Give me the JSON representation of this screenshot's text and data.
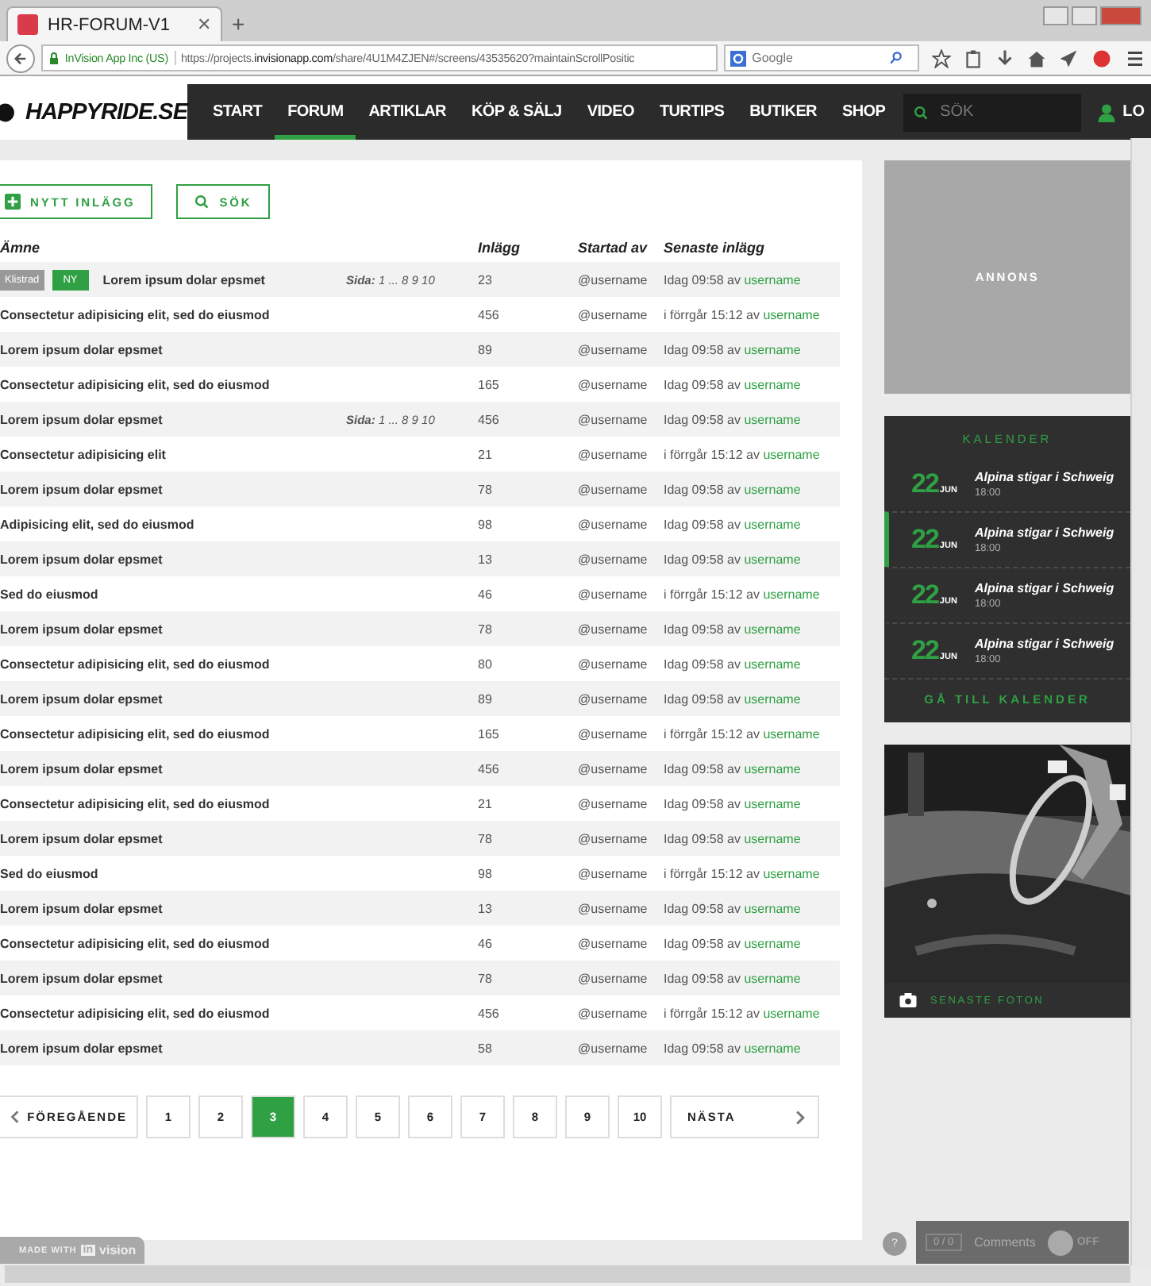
{
  "browser": {
    "tab": "HR-FORUM-V1",
    "tab_close": "✕",
    "new_tab": "+",
    "site_identity": "InVision App Inc (US)",
    "url_prefix": "https://projects.",
    "url_domain": "invisionapp.com",
    "url_rest": "/share/4U1M4ZJEN#/screens/43535620?maintainScrollPositic",
    "search_placeholder": "Google"
  },
  "site": {
    "logo": "HAPPYRIDE.SE",
    "nav": [
      {
        "label": "START",
        "selected": false
      },
      {
        "label": "FORUM",
        "selected": true
      },
      {
        "label": "ARTIKLAR",
        "selected": false
      },
      {
        "label": "KÖP & SÄLJ",
        "selected": false
      },
      {
        "label": "VIDEO",
        "selected": false
      },
      {
        "label": "TURTIPS",
        "selected": false
      },
      {
        "label": "BUTIKER",
        "selected": false
      },
      {
        "label": "SHOP",
        "selected": false
      }
    ],
    "search_placeholder": "SÖK",
    "login": "LO"
  },
  "actions": [
    "NYTT INLÄGG",
    "SÖK"
  ],
  "table": {
    "columns": [
      "Ämne",
      "Inlägg",
      "Startad av",
      "Senaste inlägg"
    ],
    "rows": [
      {
        "tags": [
          "Klistrad",
          "NY"
        ],
        "title": "Lorem ipsum dolar epsmet",
        "pages": {
          "label": "Sida:",
          "value": "1 ... 8 9 10"
        },
        "posts": "23",
        "starter": "@username",
        "latest": "Idag 09:58 av",
        "latest_user": "username"
      },
      {
        "title": "Consectetur adipisicing elit, sed do eiusmod",
        "posts": "456",
        "starter": "@username",
        "latest": "i förrgår 15:12 av",
        "latest_user": "username"
      },
      {
        "title": "Lorem ipsum dolar epsmet",
        "posts": "89",
        "starter": "@username",
        "latest": "Idag 09:58 av",
        "latest_user": "username"
      },
      {
        "title": "Consectetur adipisicing elit, sed do eiusmod",
        "posts": "165",
        "starter": "@username",
        "latest": "Idag 09:58 av",
        "latest_user": "username"
      },
      {
        "title": "Lorem ipsum dolar epsmet",
        "pages": {
          "label": "Sida:",
          "value": "1 ... 8 9 10"
        },
        "posts": "456",
        "starter": "@username",
        "latest": "Idag 09:58 av",
        "latest_user": "username"
      },
      {
        "title": "Consectetur adipisicing elit",
        "posts": "21",
        "starter": "@username",
        "latest": "i förrgår 15:12 av",
        "latest_user": "username"
      },
      {
        "title": "Lorem ipsum dolar epsmet",
        "posts": "78",
        "starter": "@username",
        "latest": "Idag 09:58 av",
        "latest_user": "username"
      },
      {
        "title": "Adipisicing elit, sed do eiusmod",
        "posts": "98",
        "starter": "@username",
        "latest": "Idag 09:58 av",
        "latest_user": "username"
      },
      {
        "title": "Lorem ipsum dolar epsmet",
        "posts": "13",
        "starter": "@username",
        "latest": "Idag 09:58 av",
        "latest_user": "username"
      },
      {
        "title": "Sed do eiusmod",
        "posts": "46",
        "starter": "@username",
        "latest": "i förrgår 15:12 av",
        "latest_user": "username"
      },
      {
        "title": "Lorem ipsum dolar epsmet",
        "posts": "78",
        "starter": "@username",
        "latest": "Idag 09:58 av",
        "latest_user": "username"
      },
      {
        "title": "Consectetur adipisicing elit, sed do eiusmod",
        "posts": "80",
        "starter": "@username",
        "latest": "Idag 09:58 av",
        "latest_user": "username"
      },
      {
        "title": "Lorem ipsum dolar epsmet",
        "posts": "89",
        "starter": "@username",
        "latest": "Idag 09:58 av",
        "latest_user": "username"
      },
      {
        "title": "Consectetur adipisicing elit, sed do eiusmod",
        "posts": "165",
        "starter": "@username",
        "latest": "i förrgår 15:12 av",
        "latest_user": "username"
      },
      {
        "title": "Lorem ipsum dolar epsmet",
        "posts": "456",
        "starter": "@username",
        "latest": "Idag 09:58 av",
        "latest_user": "username"
      },
      {
        "title": "Consectetur adipisicing elit, sed do eiusmod",
        "posts": "21",
        "starter": "@username",
        "latest": "Idag 09:58 av",
        "latest_user": "username"
      },
      {
        "title": "Lorem ipsum dolar epsmet",
        "posts": "78",
        "starter": "@username",
        "latest": "Idag 09:58 av",
        "latest_user": "username"
      },
      {
        "title": "Sed do eiusmod",
        "posts": "98",
        "starter": "@username",
        "latest": "i förrgår 15:12 av",
        "latest_user": "username"
      },
      {
        "title": "Lorem ipsum dolar epsmet",
        "posts": "13",
        "starter": "@username",
        "latest": "Idag 09:58 av",
        "latest_user": "username"
      },
      {
        "title": "Consectetur adipisicing elit, sed do eiusmod",
        "posts": "46",
        "starter": "@username",
        "latest": "Idag 09:58 av",
        "latest_user": "username"
      },
      {
        "title": "Lorem ipsum dolar epsmet",
        "posts": "78",
        "starter": "@username",
        "latest": "Idag 09:58 av",
        "latest_user": "username"
      },
      {
        "title": "Consectetur adipisicing elit, sed do eiusmod",
        "posts": "456",
        "starter": "@username",
        "latest": "i förrgår 15:12 av",
        "latest_user": "username"
      },
      {
        "title": "Lorem ipsum dolar epsmet",
        "posts": "58",
        "starter": "@username",
        "latest": "Idag 09:58 av",
        "latest_user": "username"
      }
    ]
  },
  "pagination": {
    "previous": "FÖREGÅENDE",
    "next": "NÄSTA",
    "pages": [
      {
        "label": "1",
        "selected": false
      },
      {
        "label": "2",
        "selected": false
      },
      {
        "label": "3",
        "selected": true
      },
      {
        "label": "4",
        "selected": false
      },
      {
        "label": "5",
        "selected": false
      },
      {
        "label": "6",
        "selected": false
      },
      {
        "label": "7",
        "selected": false
      },
      {
        "label": "8",
        "selected": false
      },
      {
        "label": "9",
        "selected": false
      },
      {
        "label": "10",
        "selected": false
      }
    ]
  },
  "sidebar": {
    "ad": "ANNONS",
    "calendar": {
      "title": "KALENDER",
      "link": "GÅ TILL KALENDER",
      "events": [
        {
          "day": "22",
          "month": "JUN",
          "title": "Alpina stigar i Schweig",
          "time": "18:00",
          "selected": false
        },
        {
          "day": "22",
          "month": "JUN",
          "title": "Alpina stigar i Schweig",
          "time": "18:00",
          "selected": true
        },
        {
          "day": "22",
          "month": "JUN",
          "title": "Alpina stigar i Schweig",
          "time": "18:00",
          "selected": false
        },
        {
          "day": "22",
          "month": "JUN",
          "title": "Alpina stigar i Schweig",
          "time": "18:00",
          "selected": false
        }
      ]
    },
    "photos": {
      "kind": "picture",
      "caption": "SENASTE FOTON"
    }
  },
  "overlay": {
    "made_with": "MADE WITH",
    "brand_mark": "in",
    "brand_rest": "vision",
    "help": "?",
    "comment_count": "0 / 0",
    "comments": "Comments",
    "toggle": "OFF"
  }
}
